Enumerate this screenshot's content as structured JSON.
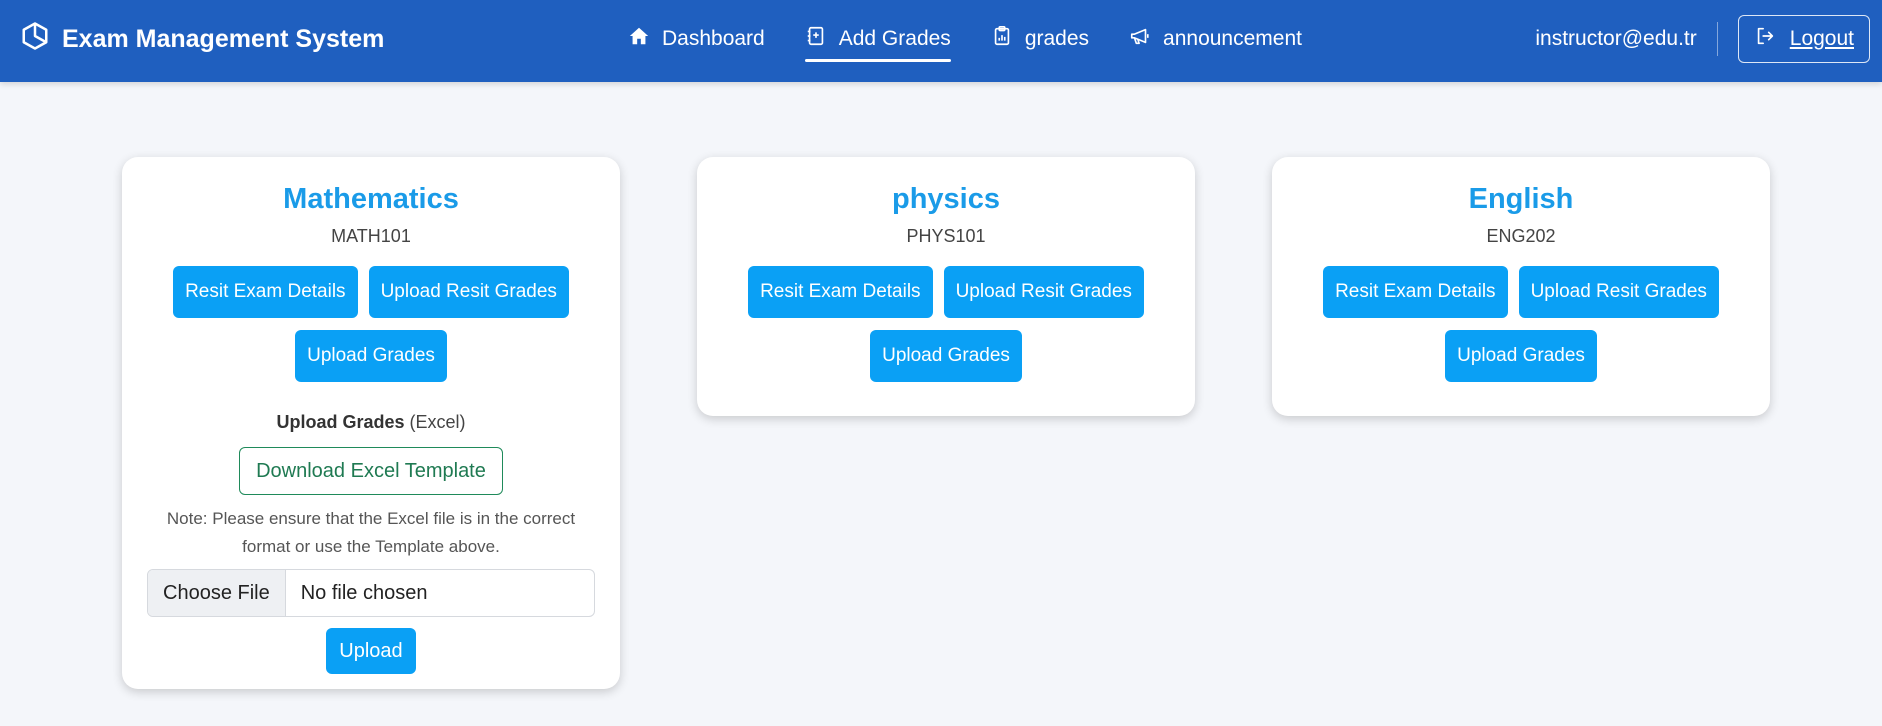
{
  "app": {
    "title": "Exam Management System",
    "brand_icon": "cube-icon"
  },
  "nav": {
    "items": [
      {
        "label": "Dashboard",
        "icon": "home-icon",
        "active": false
      },
      {
        "label": "Add Grades",
        "icon": "journal-plus-icon",
        "active": true
      },
      {
        "label": "grades",
        "icon": "clipboard-chart-icon",
        "active": false
      },
      {
        "label": "announcement",
        "icon": "megaphone-icon",
        "active": false
      }
    ],
    "user_email": "instructor@edu.tr",
    "logout_label": "Logout"
  },
  "colors": {
    "navbar": "#1f5fbf",
    "accent": "#0aa0f5",
    "course_title": "#1a9be8",
    "outline_green": "#1f7a52",
    "background": "#f4f6fa"
  },
  "courses": [
    {
      "name": "Mathematics",
      "code": "MATH101",
      "buttons": {
        "resit_details": "Resit Exam Details",
        "upload_resit": "Upload Resit Grades",
        "upload_grades": "Upload Grades"
      },
      "upload_panel": {
        "heading_bold": "Upload Grades",
        "heading_suffix": "(Excel)",
        "download_template": "Download Excel Template",
        "note": "Note: Please ensure that the Excel file is in the correct format or use the Template above.",
        "choose_file": "Choose File",
        "file_status": "No file chosen",
        "upload": "Upload"
      }
    },
    {
      "name": "physics",
      "code": "PHYS101",
      "buttons": {
        "resit_details": "Resit Exam Details",
        "upload_resit": "Upload Resit Grades",
        "upload_grades": "Upload Grades"
      }
    },
    {
      "name": "English",
      "code": "ENG202",
      "buttons": {
        "resit_details": "Resit Exam Details",
        "upload_resit": "Upload Resit Grades",
        "upload_grades": "Upload Grades"
      }
    }
  ]
}
